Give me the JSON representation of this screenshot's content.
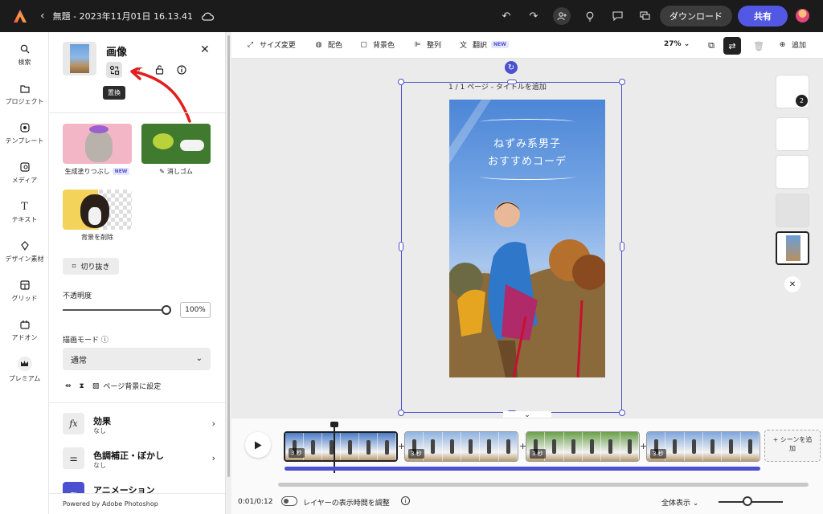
{
  "header": {
    "doc_title": "無題 - 2023年11月01日 16.13.41",
    "download_label": "ダウンロード",
    "share_label": "共有",
    "accent": "#5258e4"
  },
  "leftnav": {
    "items": [
      {
        "label": "検索",
        "icon": "search-icon"
      },
      {
        "label": "プロジェクト",
        "icon": "folder-icon"
      },
      {
        "label": "テンプレート",
        "icon": "template-icon"
      },
      {
        "label": "メディア",
        "icon": "media-icon"
      },
      {
        "label": "テキスト",
        "icon": "text-icon"
      },
      {
        "label": "デザイン素材",
        "icon": "shapes-icon"
      },
      {
        "label": "グリッド",
        "icon": "grid-icon"
      },
      {
        "label": "アドオン",
        "icon": "addon-icon"
      },
      {
        "label": "プレミアム",
        "icon": "crown-icon"
      }
    ]
  },
  "panel": {
    "title": "画像",
    "tooltip": "置換",
    "features": [
      {
        "label": "生成塗りつぶし",
        "badge": "NEW"
      },
      {
        "label": "消しゴム"
      },
      {
        "label": "背景を削除"
      }
    ],
    "crop_label": "切り抜き",
    "opacity_label": "不透明度",
    "opacity_value": "100%",
    "blend_label": "描画モード",
    "blend_value": "通常",
    "page_bg_label": "ページ背景に設定",
    "sections": [
      {
        "title": "効果",
        "sub": "なし"
      },
      {
        "title": "色調補正・ぼかし",
        "sub": "なし"
      },
      {
        "title": "アニメーション",
        "sub": ""
      }
    ],
    "powered": "Powered by Adobe Photoshop"
  },
  "toolbar": {
    "resize": "サイズ変更",
    "color": "配色",
    "background": "背景色",
    "arrange": "整列",
    "translate": "翻訳",
    "translate_badge": "NEW",
    "zoom": "27%",
    "add": "追加"
  },
  "canvas": {
    "page_label": "1 / 1 ページ - タイトルを追加",
    "photo_title_line1": "ねずみ系男子",
    "photo_title_line2": "おすすめコーデ"
  },
  "thumbs": {
    "badge": "2"
  },
  "timeline": {
    "clips": [
      {
        "duration": "3 秒",
        "color": "#4a7bc8"
      },
      {
        "duration": "3 秒",
        "color": "#8fb3e0"
      },
      {
        "duration": "3 秒",
        "color": "#6aa04a"
      },
      {
        "duration": "3 秒",
        "color": "#7fa6dc"
      }
    ],
    "add_scene": "+ シーンを追加",
    "time": "0:01/0:12",
    "toggle_label": "レイヤーの表示時間を調整",
    "view_all": "全体表示"
  }
}
